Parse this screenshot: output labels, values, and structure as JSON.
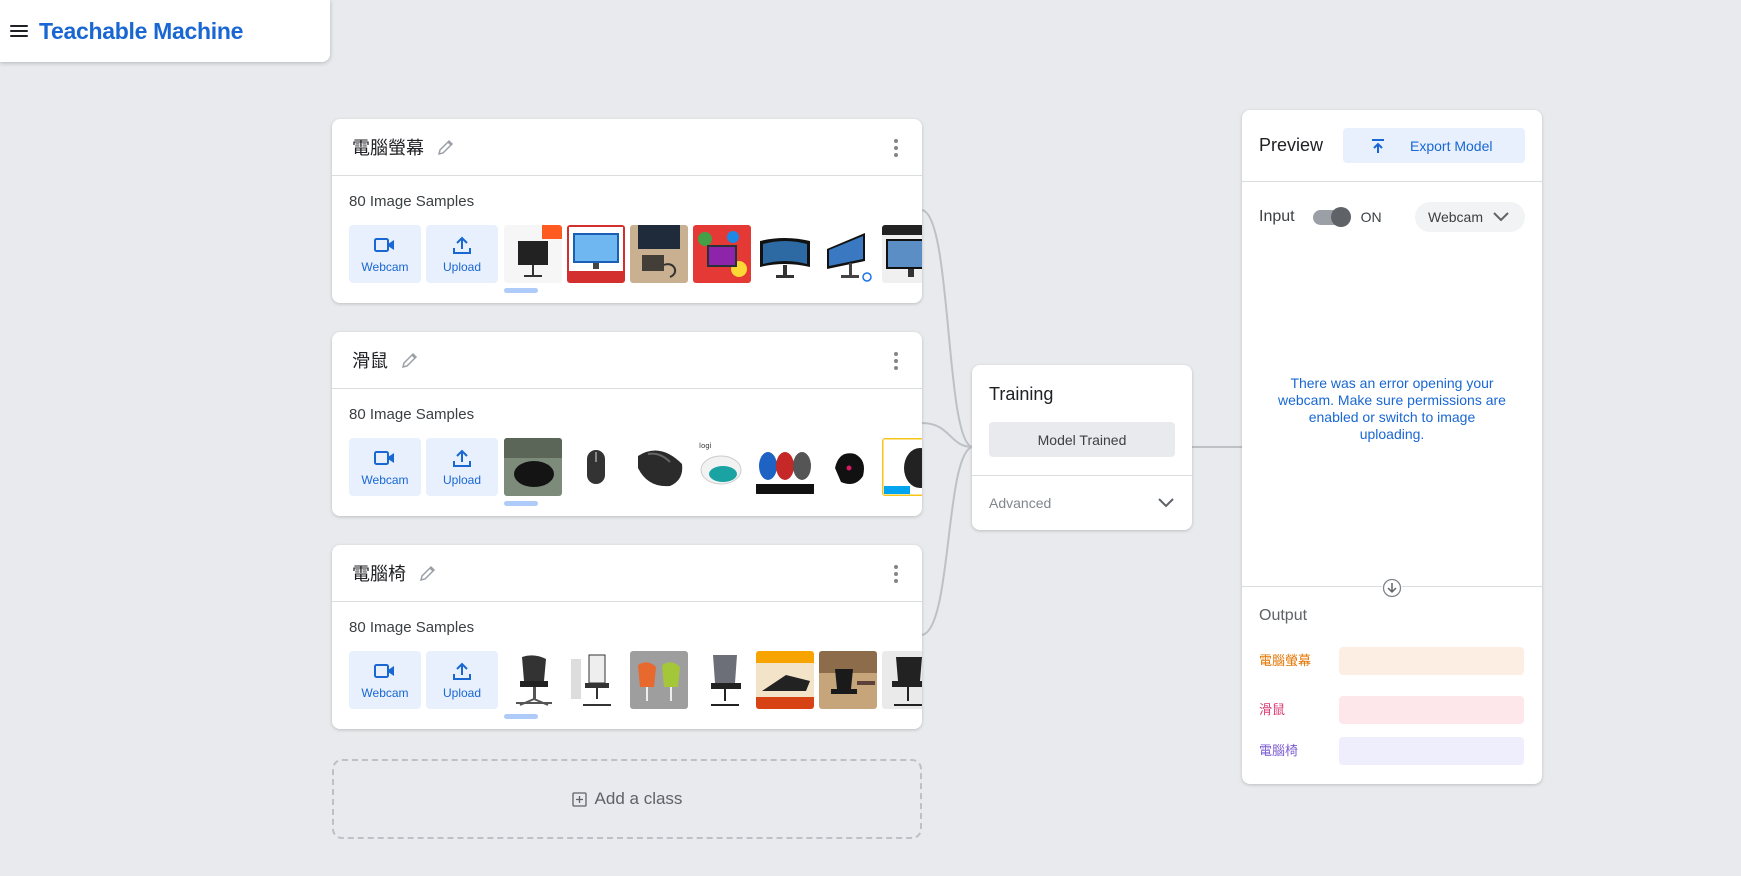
{
  "app": {
    "title": "Teachable Machine"
  },
  "classes": [
    {
      "name": "電腦螢幕",
      "samples": "80 Image Samples",
      "webcam_label": "Webcam",
      "upload_label": "Upload"
    },
    {
      "name": "滑鼠",
      "samples": "80 Image Samples",
      "webcam_label": "Webcam",
      "upload_label": "Upload"
    },
    {
      "name": "電腦椅",
      "samples": "80 Image Samples",
      "webcam_label": "Webcam",
      "upload_label": "Upload"
    }
  ],
  "add_class": {
    "label": "Add a class"
  },
  "training": {
    "title": "Training",
    "button": "Model Trained",
    "advanced": "Advanced"
  },
  "preview": {
    "title": "Preview",
    "export_label": "Export Model",
    "input_label": "Input",
    "toggle_state": "ON",
    "source": "Webcam",
    "error": "There was an error opening your webcam. Make sure permissions are enabled or switch to image uploading.",
    "output_label": "Output",
    "outputs": [
      {
        "name": "電腦螢幕",
        "color": "#e37400",
        "bar": "#fdeee4"
      },
      {
        "name": "滑鼠",
        "color": "#d93b73",
        "bar": "#fde7ea"
      },
      {
        "name": "電腦椅",
        "color": "#7b5cd1",
        "bar": "#efeefc"
      }
    ]
  },
  "icons": {
    "menu": "menu-icon",
    "edit": "pencil-icon",
    "more": "kebab-icon",
    "webcam": "video-camera-icon",
    "upload": "upload-icon",
    "add": "add-box-icon",
    "chevron": "chevron-down-icon",
    "export": "export-icon",
    "arrow": "arrow-down-icon"
  },
  "colors": {
    "accent": "#1967d2",
    "accent_light": "#e8f0fe",
    "background": "#e8eaed"
  }
}
